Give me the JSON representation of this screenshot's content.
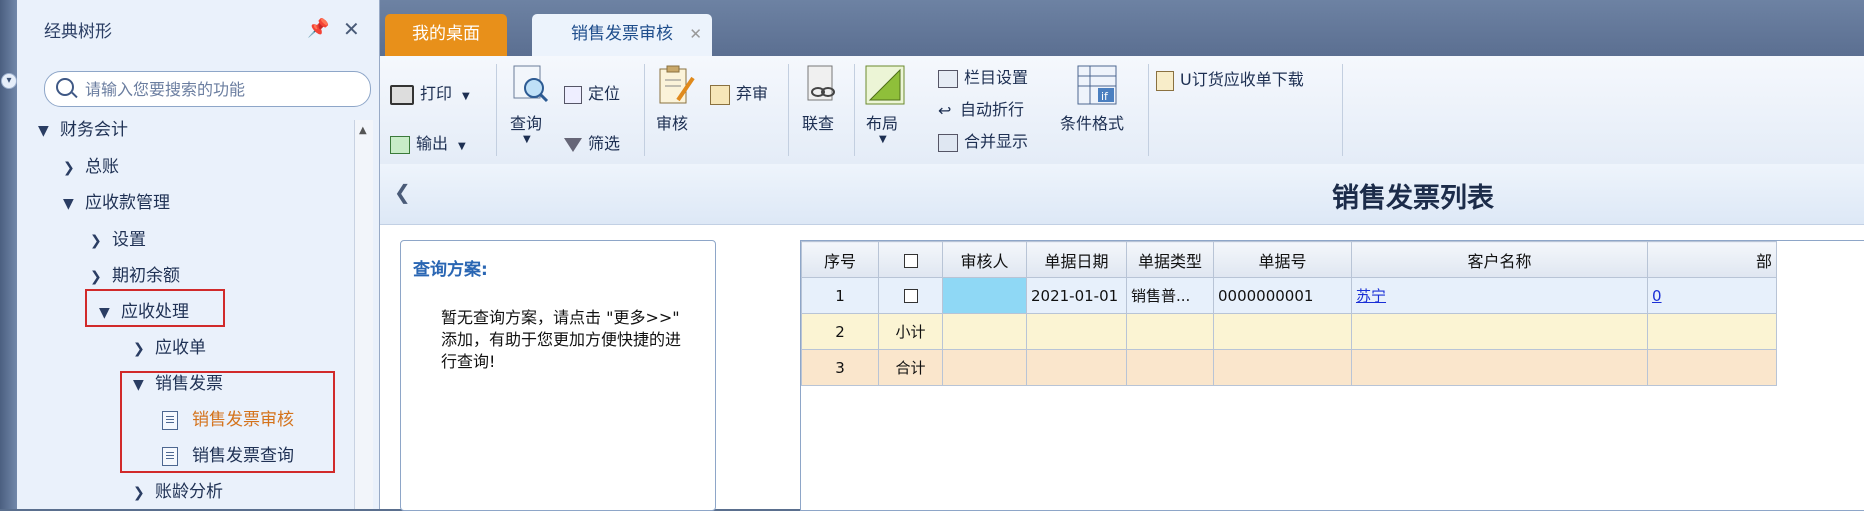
{
  "tree": {
    "title": "经典树形",
    "search_placeholder": "请输入您要搜索的功能",
    "nodes": {
      "finance": "财务会计",
      "ledger": "总账",
      "receivables": "应收款管理",
      "settings": "设置",
      "opening_balance": "期初余额",
      "ar_processing": "应收处理",
      "ar_doc": "应收单",
      "sales_invoice": "销售发票",
      "invoice_audit": "销售发票审核",
      "invoice_query": "销售发票查询",
      "aging": "账龄分析"
    }
  },
  "tabs": {
    "desktop": "我的桌面",
    "invoice_audit": "销售发票审核"
  },
  "ribbon": {
    "print": "打印",
    "export": "输出",
    "query": "查询",
    "locate": "定位",
    "filter": "筛选",
    "audit": "审核",
    "abandon": "弃审",
    "link_query": "联查",
    "layout": "布局",
    "column_settings": "栏目设置",
    "auto_wrap": "自动折行",
    "merge_display": "合并显示",
    "condition_format": "条件格式",
    "u_order_download": "U订货应收单下载"
  },
  "list_title": "销售发票列表",
  "query_panel": {
    "label": "查询方案:",
    "message": "暂无查询方案，请点击 \"更多>>\" 添加，有助于您更加方便快捷的进行查询!"
  },
  "grid": {
    "headers": [
      "序号",
      "",
      "审核人",
      "单据日期",
      "单据类型",
      "单据号",
      "客户名称",
      "部"
    ],
    "rows": [
      {
        "seq": "1",
        "check": "",
        "auditor": "",
        "date": "2021-01-01",
        "type": "销售普...",
        "number": "0000000001",
        "customer": "苏宁",
        "dept": "0"
      },
      {
        "seq": "2",
        "check": "小计",
        "auditor": "",
        "date": "",
        "type": "",
        "number": "",
        "customer": "",
        "dept": ""
      },
      {
        "seq": "3",
        "check": "合计",
        "auditor": "",
        "date": "",
        "type": "",
        "number": "",
        "customer": "",
        "dept": ""
      }
    ]
  },
  "colors": {
    "accent_orange": "#e8901a",
    "active_item": "#d4731c",
    "highlight_box": "#d12a2a",
    "selected_cell": "#8fd8f5"
  }
}
